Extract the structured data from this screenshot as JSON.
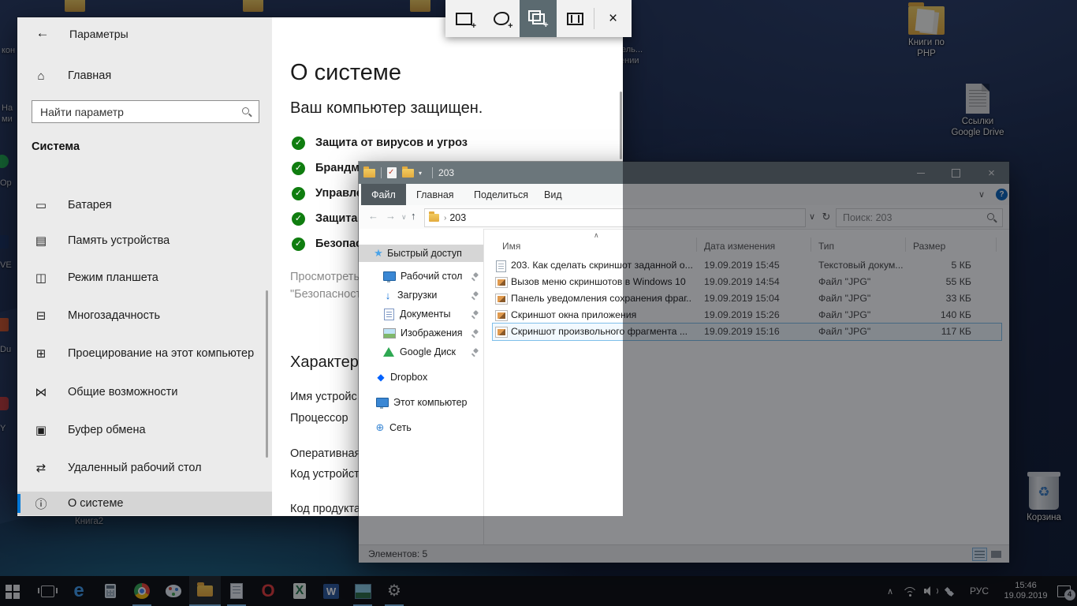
{
  "colors": {
    "accent": "#0078d7",
    "check_green": "#0f7d0f",
    "explorer_titlebar": "#6b767b",
    "selection_border": "#7fbfea",
    "snip_selected_bg": "#5b6a70"
  },
  "snip": {
    "buttons": [
      "rectangular-snip",
      "freeform-snip",
      "window-snip",
      "fullscreen-snip",
      "close"
    ],
    "selected": "window-snip"
  },
  "settings": {
    "title": "Параметры",
    "home": "Главная",
    "search_placeholder": "Найти параметр",
    "section": "Система",
    "nav": [
      {
        "icon": "battery-icon",
        "label": "Батарея"
      },
      {
        "icon": "storage-icon",
        "label": "Память устройства"
      },
      {
        "icon": "tablet-mode-icon",
        "label": "Режим планшета"
      },
      {
        "icon": "multitasking-icon",
        "label": "Многозадачность"
      },
      {
        "icon": "projecting-icon",
        "label": "Проецирование на этот компьютер"
      },
      {
        "icon": "shared-experiences-icon",
        "label": "Общие возможности"
      },
      {
        "icon": "clipboard-icon",
        "label": "Буфер обмена"
      },
      {
        "icon": "remote-desktop-icon",
        "label": "Удаленный рабочий стол"
      },
      {
        "icon": "about-icon",
        "label": "О системе",
        "selected": true
      }
    ],
    "about": {
      "title": "О системе",
      "subtitle": "Ваш компьютер защищен.",
      "checks": [
        "Защита от вирусов и угроз",
        "Брандма",
        "Управле",
        "Защита у",
        "Безопасн"
      ],
      "link_line1": "Просмотреть",
      "link_line2": "\"Безопасност",
      "specs_title": "Характери",
      "spec_labels": [
        "Имя устройс",
        "Процессор",
        "Оперативная",
        "Код устройст",
        "Код продукта"
      ]
    }
  },
  "explorer": {
    "title": "203",
    "tabs": [
      "Файл",
      "Главная",
      "Поделиться",
      "Вид"
    ],
    "breadcrumb": "203",
    "search_placeholder": "Поиск: 203",
    "sidebar": {
      "quick_access": "Быстрый доступ",
      "pinned": [
        "Рабочий стол",
        "Загрузки",
        "Документы",
        "Изображения",
        "Google Диск"
      ],
      "items": [
        "Dropbox",
        "Этот компьютер",
        "Сеть"
      ]
    },
    "columns": [
      "Имя",
      "Дата изменения",
      "Тип",
      "Размер"
    ],
    "files": [
      {
        "name": "203. Как сделать скриншот заданной о...",
        "date": "19.09.2019 15:45",
        "type": "Текстовый докум...",
        "size": "5 КБ"
      },
      {
        "name": "Вызов меню скриншотов в Windows 10",
        "date": "19.09.2019 14:54",
        "type": "Файл \"JPG\"",
        "size": "55 КБ"
      },
      {
        "name": "Панель уведомления сохранения фраг...",
        "date": "19.09.2019 15:04",
        "type": "Файл \"JPG\"",
        "size": "33 КБ"
      },
      {
        "name": "Скриншот окна приложения",
        "date": "19.09.2019 15:26",
        "type": "Файл \"JPG\"",
        "size": "140 КБ"
      },
      {
        "name": "Скриншот произвольного фрагмента ...",
        "date": "19.09.2019 15:16",
        "type": "Файл \"JPG\"",
        "size": "117 КБ",
        "selected": true
      }
    ],
    "status": "Элементов: 5"
  },
  "desktop": {
    "icon_books_line1": "Книги по",
    "icon_books_line2": "PHP",
    "icon_links_line1": "Ссылки",
    "icon_links_line2": "Google Drive",
    "icon_bin": "Корзина",
    "excel_label": "Книга2",
    "partials": {
      "p0": "кон",
      "p1": "На",
      "p2": "ми",
      "p3": "Op",
      "p4": "VE",
      "p5": "Du",
      "p6": "Y",
      "p7": "ель...",
      "p8": "ении"
    }
  },
  "taskbar": {
    "glyphs": {
      "edge": "e",
      "opera": "O",
      "excel": "X",
      "word": "W"
    },
    "tray": {
      "lang": "РУС",
      "time": "15:46",
      "date": "19.09.2019",
      "badge": "4"
    }
  }
}
